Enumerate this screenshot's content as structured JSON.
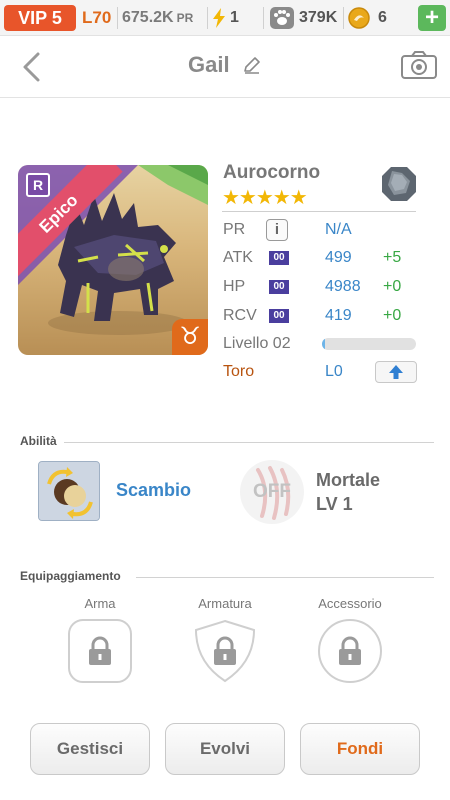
{
  "status_bar": {
    "vip": "VIP 5",
    "level": "L70",
    "pr_value": "675.2K",
    "pr_unit": "PR",
    "energy": "1",
    "paws": "379K",
    "coins": "6",
    "plus_icon": "plus-icon"
  },
  "header": {
    "title": "Gail",
    "back_icon": "chevron-left-icon",
    "edit_icon": "pencil-icon",
    "camera_icon": "camera-icon"
  },
  "creature": {
    "name": "Aurocorno",
    "rarity": "Epico",
    "rank_badge": "R",
    "stars": "★★★★★",
    "star_count": 5,
    "zodiac_symbol": "♉",
    "element_icon": "rock-element-icon",
    "stats": {
      "pr": {
        "label": "PR",
        "value": "N/A",
        "info": "i"
      },
      "atk": {
        "label": "ATK",
        "pill": "00",
        "value": "499",
        "bonus": "+5"
      },
      "hp": {
        "label": "HP",
        "pill": "00",
        "value": "4988",
        "bonus": "+0"
      },
      "rcv": {
        "label": "RCV",
        "pill": "00",
        "value": "419",
        "bonus": "+0"
      }
    },
    "level": {
      "label": "Livello 02",
      "progress": 0.03
    },
    "zodiac": {
      "label": "Toro",
      "value": "L0",
      "up_icon": "arrow-up-icon"
    }
  },
  "abilities": {
    "title": "Abilità",
    "active": {
      "name": "Scambio",
      "icon": "swap-orb-icon"
    },
    "passive": {
      "status": "OFF",
      "name": "Mortale",
      "level": "LV 1",
      "icon": "claw-icon"
    }
  },
  "equipment": {
    "title": "Equipaggiamento",
    "slots": [
      {
        "label": "Arma",
        "icon": "lock-icon"
      },
      {
        "label": "Armatura",
        "icon": "lock-icon"
      },
      {
        "label": "Accessorio",
        "icon": "lock-icon"
      }
    ]
  },
  "actions": {
    "manage": "Gestisci",
    "evolve": "Evolvi",
    "merge": "Fondi"
  },
  "colors": {
    "accent_orange": "#e06a1b",
    "stat_blue": "#3a86c8",
    "bonus_green": "#39a845",
    "star_gold": "#f2b705",
    "rarity_pink": "#e24f6b"
  }
}
